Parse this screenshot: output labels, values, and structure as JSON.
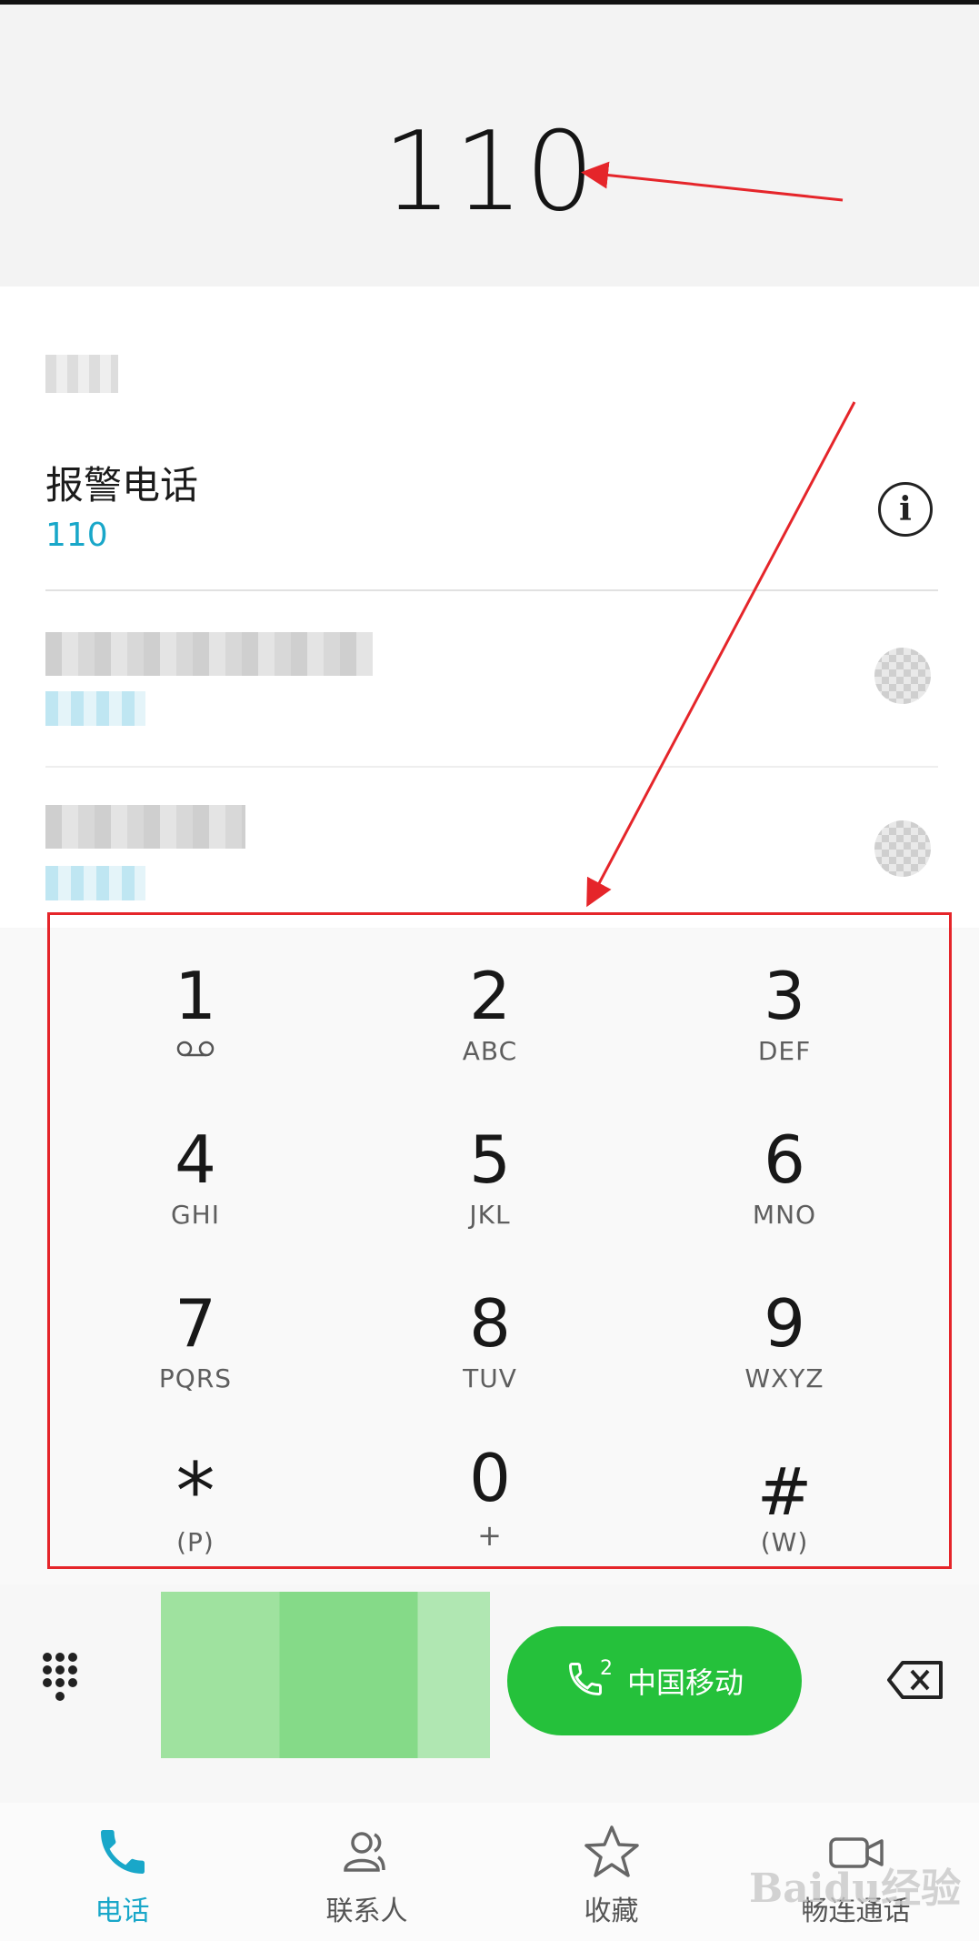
{
  "dialed_number": "110",
  "results": {
    "top_contact": {
      "name": "报警电话",
      "number": "110"
    }
  },
  "keypad": {
    "keys": [
      {
        "digit": "1",
        "letters": ""
      },
      {
        "digit": "2",
        "letters": "ABC"
      },
      {
        "digit": "3",
        "letters": "DEF"
      },
      {
        "digit": "4",
        "letters": "GHI"
      },
      {
        "digit": "5",
        "letters": "JKL"
      },
      {
        "digit": "6",
        "letters": "MNO"
      },
      {
        "digit": "7",
        "letters": "PQRS"
      },
      {
        "digit": "8",
        "letters": "TUV"
      },
      {
        "digit": "9",
        "letters": "WXYZ"
      },
      {
        "digit": "*",
        "letters": "(P)"
      },
      {
        "digit": "0",
        "letters": "+"
      },
      {
        "digit": "#",
        "letters": "(W)"
      }
    ]
  },
  "call_button": {
    "sim_index": "2",
    "label": "中国移动"
  },
  "tabs": [
    {
      "label": "电话",
      "icon": "phone-icon",
      "active": true
    },
    {
      "label": "联系人",
      "icon": "contacts-icon",
      "active": false
    },
    {
      "label": "收藏",
      "icon": "star-icon",
      "active": false
    },
    {
      "label": "畅连通话",
      "icon": "video-call-icon",
      "active": false
    }
  ],
  "watermark": "Baidu经验",
  "colors": {
    "accent": "#19a7c9",
    "call_green": "#25c13b",
    "annotation_red": "#e5252a"
  }
}
